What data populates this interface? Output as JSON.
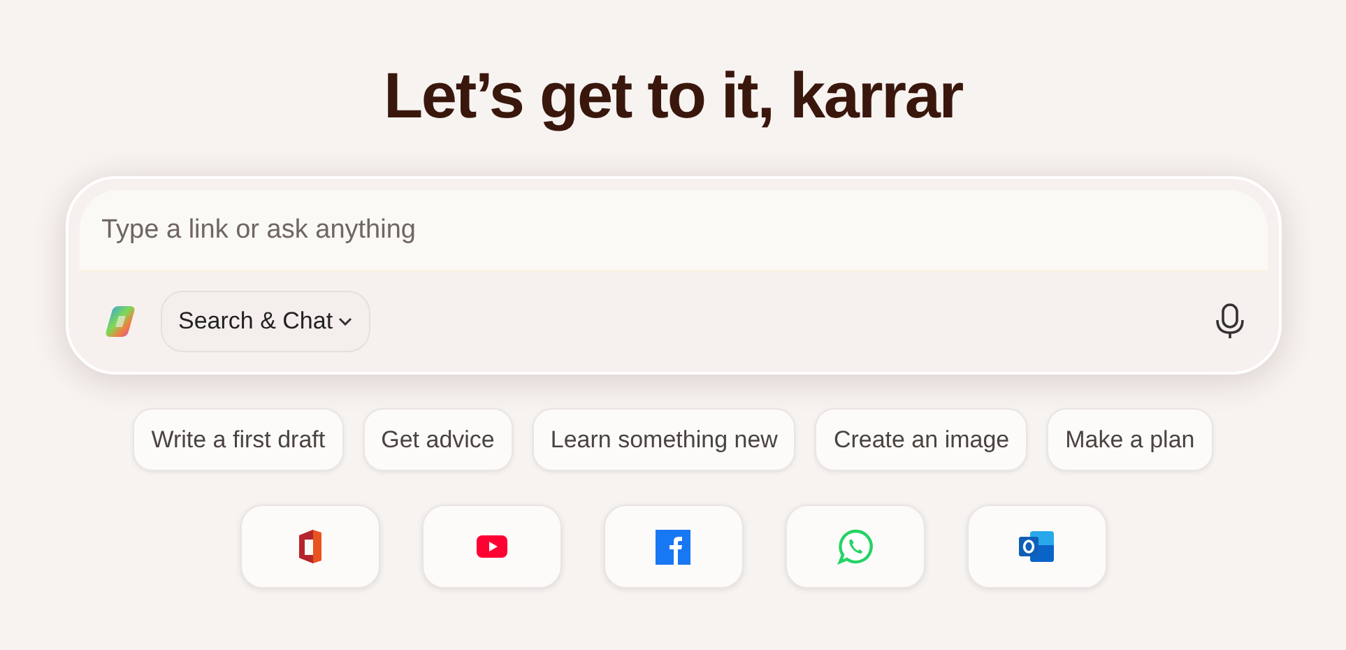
{
  "heading": "Let’s get to it, karrar",
  "composer": {
    "placeholder": "Type a link or ask anything",
    "mode": "Search & Chat"
  },
  "prompts": [
    "Write a first draft",
    "Get advice",
    "Learn something new",
    "Create an image",
    "Make a plan"
  ],
  "shortcuts": [
    {
      "kind": "office"
    },
    {
      "kind": "youtube"
    },
    {
      "kind": "facebook"
    },
    {
      "kind": "whatsapp"
    },
    {
      "kind": "outlook"
    }
  ]
}
